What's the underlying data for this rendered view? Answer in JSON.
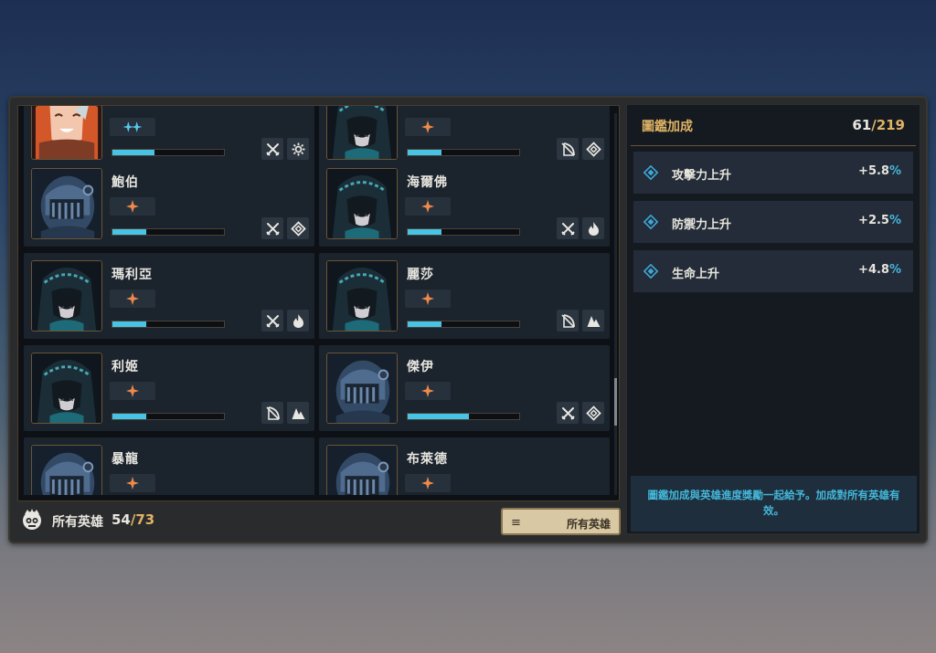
{
  "collection": {
    "total_label": "所有英雄",
    "owned": "54",
    "separator": "/",
    "total": "73",
    "filter_button": "所有英雄",
    "filter_icon": "≡"
  },
  "heroes": [
    {
      "name": "",
      "portrait": "orange-hair",
      "stars": "double-blue",
      "progress": 0.38,
      "icons": [
        "swords-icon",
        "gear-icon"
      ]
    },
    {
      "name": "",
      "portrait": "hooded",
      "stars": "single-orange",
      "progress": 0.3,
      "icons": [
        "bow-icon",
        "diamond-icon"
      ]
    },
    {
      "name": "鮑伯",
      "portrait": "knight",
      "stars": "single-orange",
      "progress": 0.3,
      "icons": [
        "swords-icon",
        "diamond-icon"
      ]
    },
    {
      "name": "海爾佛",
      "portrait": "hooded",
      "stars": "single-orange",
      "progress": 0.3,
      "icons": [
        "swords-icon",
        "fire-icon"
      ]
    },
    {
      "name": "瑪利亞",
      "portrait": "hooded",
      "stars": "single-orange",
      "progress": 0.3,
      "icons": [
        "swords-icon",
        "fire-icon"
      ]
    },
    {
      "name": "麗莎",
      "portrait": "hooded",
      "stars": "single-orange",
      "progress": 0.3,
      "icons": [
        "bow-icon",
        "mountain-icon"
      ]
    },
    {
      "name": "利姬",
      "portrait": "hooded",
      "stars": "single-orange",
      "progress": 0.3,
      "icons": [
        "bow-icon",
        "mountain-icon"
      ]
    },
    {
      "name": "傑伊",
      "portrait": "knight",
      "stars": "single-orange",
      "progress": 0.55,
      "icons": [
        "swords-icon",
        "diamond-icon"
      ]
    },
    {
      "name": "暴龍",
      "portrait": "knight",
      "stars": "single-orange",
      "progress": 0.3,
      "icons": []
    },
    {
      "name": "布萊德",
      "portrait": "knight",
      "stars": "single-orange",
      "progress": 0.3,
      "icons": []
    }
  ],
  "bonus": {
    "title": "圖鑑加成",
    "collected": "61",
    "separator": "/",
    "total": "219",
    "stats": [
      {
        "name": "攻擊力上升",
        "value": "+5.8",
        "unit": "%"
      },
      {
        "name": "防禦力上升",
        "value": "+2.5",
        "unit": "%"
      },
      {
        "name": "生命上升",
        "value": "+4.8",
        "unit": "%"
      }
    ],
    "note": "圖鑑加成與英雄進度獎勵一起給予。加成對所有英雄有效。"
  },
  "colors": {
    "accent_gold": "#e0b365",
    "progress_blue": "#47c3e6",
    "star_orange": "#f08a4b",
    "note_text": "#43b7d9"
  }
}
